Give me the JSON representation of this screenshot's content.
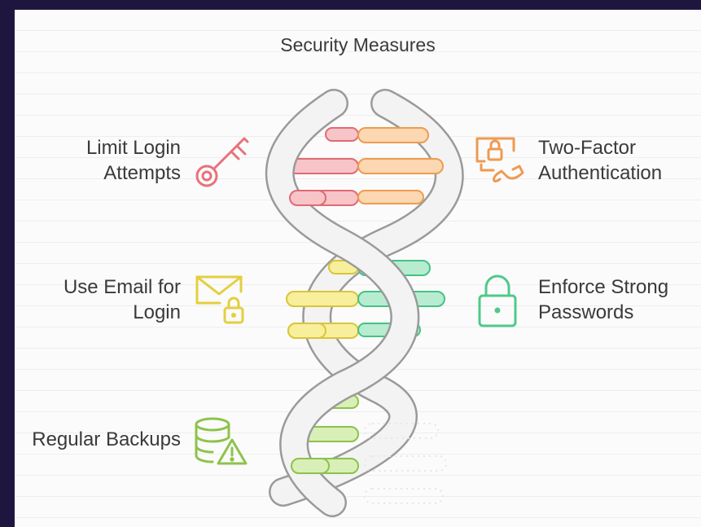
{
  "diagram": {
    "title": "Security Measures",
    "items": [
      {
        "line1": "Limit Login",
        "line2": "Attempts",
        "icon": "key-icon",
        "color": "#e8717a"
      },
      {
        "line1": "Two-Factor",
        "line2": "Authentication",
        "icon": "phone-lock-icon",
        "color": "#ef9a52"
      },
      {
        "line1": "Use Email for",
        "line2": "Login",
        "icon": "envelope-lock-icon",
        "color": "#e3cf3f"
      },
      {
        "line1": "Enforce Strong",
        "line2": "Passwords",
        "icon": "padlock-icon",
        "color": "#4fc98b"
      },
      {
        "line1": "Regular Backups",
        "line2": "",
        "icon": "database-warning-icon",
        "color": "#8dc34a"
      }
    ]
  }
}
